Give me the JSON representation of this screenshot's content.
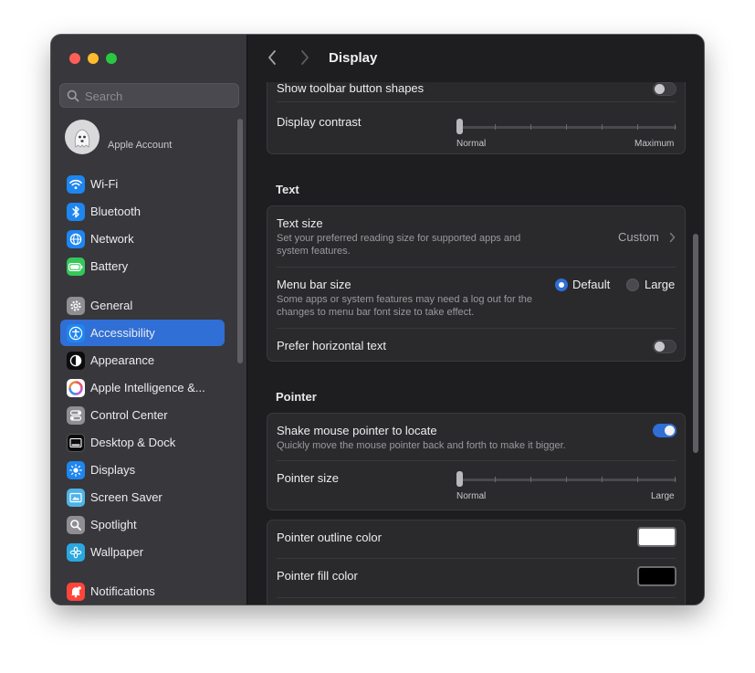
{
  "window": {
    "page_title": "Display"
  },
  "sidebar": {
    "search_placeholder": "Search",
    "account_label": "Apple Account",
    "items": [
      {
        "label": "Wi-Fi",
        "icon": "wifi-icon",
        "color": "#1e86f0"
      },
      {
        "label": "Bluetooth",
        "icon": "bluetooth-icon",
        "color": "#1e86f0"
      },
      {
        "label": "Network",
        "icon": "globe-icon",
        "color": "#1e86f0"
      },
      {
        "label": "Battery",
        "icon": "battery-icon",
        "color": "#34c759"
      },
      {
        "label": "General",
        "icon": "gear-icon",
        "color": "#8e8e93"
      },
      {
        "label": "Accessibility",
        "icon": "accessibility-icon",
        "color": "#1e86f0",
        "active": true
      },
      {
        "label": "Appearance",
        "icon": "appearance-icon",
        "color": "#1c1c1e"
      },
      {
        "label": "Apple Intelligence &...",
        "icon": "apple-intelligence-icon",
        "color": "#e8566c"
      },
      {
        "label": "Control Center",
        "icon": "control-center-icon",
        "color": "#8e8e93"
      },
      {
        "label": "Desktop & Dock",
        "icon": "dock-icon",
        "color": "#1c1c1e"
      },
      {
        "label": "Displays",
        "icon": "sun-icon",
        "color": "#1e86f0"
      },
      {
        "label": "Screen Saver",
        "icon": "screen-saver-icon",
        "color": "#4fb3e8"
      },
      {
        "label": "Spotlight",
        "icon": "magnifier-icon",
        "color": "#8e8e93"
      },
      {
        "label": "Wallpaper",
        "icon": "flower-icon",
        "color": "#2aa7e0"
      },
      {
        "label": "Notifications",
        "icon": "bell-icon",
        "color": "#ff453a"
      }
    ]
  },
  "display_group": {
    "toolbar_shapes_label": "Show toolbar button shapes",
    "toolbar_shapes_on": false,
    "contrast_label": "Display contrast",
    "contrast_min_label": "Normal",
    "contrast_max_label": "Maximum",
    "contrast_value": 0
  },
  "text_section": {
    "heading": "Text",
    "text_size_title": "Text size",
    "text_size_desc": "Set your preferred reading size for supported apps and system features.",
    "text_size_value": "Custom",
    "menu_bar_title": "Menu bar size",
    "menu_bar_desc": "Some apps or system features may need a log out for the changes to menu bar font size to take effect.",
    "menu_bar_options": [
      "Default",
      "Large"
    ],
    "menu_bar_selected": "Default",
    "horizontal_text_label": "Prefer horizontal text",
    "horizontal_text_on": false
  },
  "pointer_section": {
    "heading": "Pointer",
    "shake_title": "Shake mouse pointer to locate",
    "shake_desc": "Quickly move the mouse pointer back and forth to make it bigger.",
    "shake_on": true,
    "size_label": "Pointer size",
    "size_min_label": "Normal",
    "size_max_label": "Large",
    "size_value": 0,
    "outline_label": "Pointer outline color",
    "outline_color": "#ffffff",
    "fill_label": "Pointer fill color",
    "fill_color": "#000000"
  }
}
